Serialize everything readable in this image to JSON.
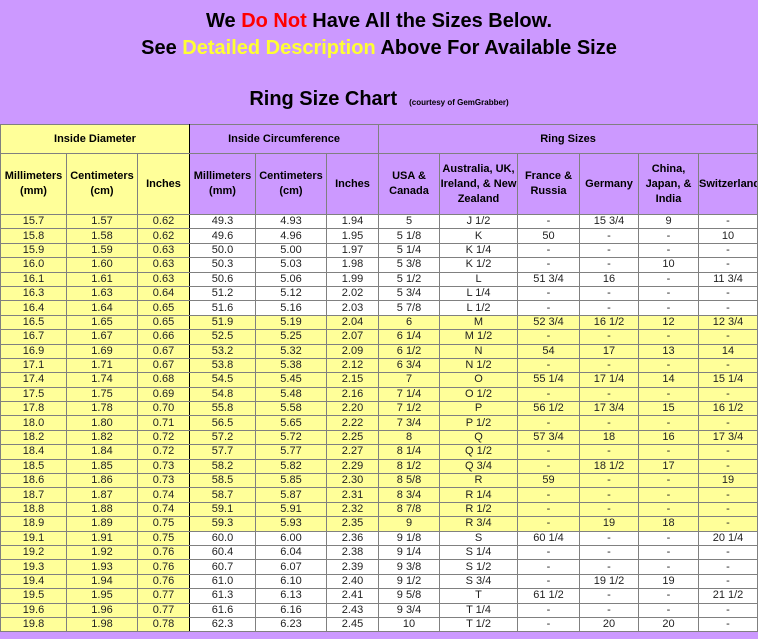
{
  "banner": {
    "line1": {
      "pre": "We ",
      "highlight": "Do Not",
      "post": " Have All the Sizes Below."
    },
    "line2": {
      "pre": "See ",
      "highlight": "Detailed Description",
      "post": " Above For Available Size"
    },
    "title": "Ring Size Chart",
    "courtesy": "(courtesy of GemGrabber)",
    "colors": {
      "background": "#cc99ff",
      "highlight_red": "#ff0000",
      "highlight_yellow": "#ffff33"
    }
  },
  "table": {
    "groups": [
      "Inside Diameter",
      "Inside Circumference",
      "Ring Sizes"
    ],
    "columns": [
      "Millimeters (mm)",
      "Centimeters (cm)",
      "Inches",
      "Millimeters (mm)",
      "Centimeters (cm)",
      "Inches",
      "USA & Canada",
      "Australia, UK, Ireland, & New Zealand",
      "France & Russia",
      "Germany",
      "China, Japan, & India",
      "Switzerland"
    ],
    "colors": {
      "yellow": "#ffff99",
      "purple": "#cc99ff",
      "white": "#ffffff"
    },
    "rows": [
      [
        "15.7",
        "1.57",
        "0.62",
        "49.3",
        "4.93",
        "1.94",
        "5",
        "J 1/2",
        "-",
        "15 3/4",
        "9",
        "-"
      ],
      [
        "15.8",
        "1.58",
        "0.62",
        "49.6",
        "4.96",
        "1.95",
        "5 1/8",
        "K",
        "50",
        "-",
        "-",
        "10"
      ],
      [
        "15.9",
        "1.59",
        "0.63",
        "50.0",
        "5.00",
        "1.97",
        "5 1/4",
        "K 1/4",
        "-",
        "-",
        "-",
        "-"
      ],
      [
        "16.0",
        "1.60",
        "0.63",
        "50.3",
        "5.03",
        "1.98",
        "5 3/8",
        "K 1/2",
        "-",
        "-",
        "10",
        "-"
      ],
      [
        "16.1",
        "1.61",
        "0.63",
        "50.6",
        "5.06",
        "1.99",
        "5 1/2",
        "L",
        "51 3/4",
        "16",
        "-",
        "11 3/4"
      ],
      [
        "16.3",
        "1.63",
        "0.64",
        "51.2",
        "5.12",
        "2.02",
        "5 3/4",
        "L 1/4",
        "-",
        "-",
        "-",
        "-"
      ],
      [
        "16.4",
        "1.64",
        "0.65",
        "51.6",
        "5.16",
        "2.03",
        "5 7/8",
        "L 1/2",
        "-",
        "-",
        "-",
        "-"
      ],
      [
        "16.5",
        "1.65",
        "0.65",
        "51.9",
        "5.19",
        "2.04",
        "6",
        "M",
        "52 3/4",
        "16 1/2",
        "12",
        "12 3/4"
      ],
      [
        "16.7",
        "1.67",
        "0.66",
        "52.5",
        "5.25",
        "2.07",
        "6 1/4",
        "M 1/2",
        "-",
        "-",
        "-",
        "-"
      ],
      [
        "16.9",
        "1.69",
        "0.67",
        "53.2",
        "5.32",
        "2.09",
        "6 1/2",
        "N",
        "54",
        "17",
        "13",
        "14"
      ],
      [
        "17.1",
        "1.71",
        "0.67",
        "53.8",
        "5.38",
        "2.12",
        "6 3/4",
        "N 1/2",
        "-",
        "-",
        "-",
        "-"
      ],
      [
        "17.4",
        "1.74",
        "0.68",
        "54.5",
        "5.45",
        "2.15",
        "7",
        "O",
        "55 1/4",
        "17 1/4",
        "14",
        "15 1/4"
      ],
      [
        "17.5",
        "1.75",
        "0.69",
        "54.8",
        "5.48",
        "2.16",
        "7 1/4",
        "O 1/2",
        "-",
        "-",
        "-",
        "-"
      ],
      [
        "17.8",
        "1.78",
        "0.70",
        "55.8",
        "5.58",
        "2.20",
        "7 1/2",
        "P",
        "56 1/2",
        "17 3/4",
        "15",
        "16 1/2"
      ],
      [
        "18.0",
        "1.80",
        "0.71",
        "56.5",
        "5.65",
        "2.22",
        "7 3/4",
        "P 1/2",
        "-",
        "-",
        "-",
        "-"
      ],
      [
        "18.2",
        "1.82",
        "0.72",
        "57.2",
        "5.72",
        "2.25",
        "8",
        "Q",
        "57 3/4",
        "18",
        "16",
        "17 3/4"
      ],
      [
        "18.4",
        "1.84",
        "0.72",
        "57.7",
        "5.77",
        "2.27",
        "8 1/4",
        "Q 1/2",
        "-",
        "-",
        "-",
        "-"
      ],
      [
        "18.5",
        "1.85",
        "0.73",
        "58.2",
        "5.82",
        "2.29",
        "8 1/2",
        "Q 3/4",
        "-",
        "18 1/2",
        "17",
        "-"
      ],
      [
        "18.6",
        "1.86",
        "0.73",
        "58.5",
        "5.85",
        "2.30",
        "8 5/8",
        "R",
        "59",
        "-",
        "-",
        "19"
      ],
      [
        "18.7",
        "1.87",
        "0.74",
        "58.7",
        "5.87",
        "2.31",
        "8 3/4",
        "R 1/4",
        "-",
        "-",
        "-",
        "-"
      ],
      [
        "18.8",
        "1.88",
        "0.74",
        "59.1",
        "5.91",
        "2.32",
        "8 7/8",
        "R 1/2",
        "-",
        "-",
        "-",
        "-"
      ],
      [
        "18.9",
        "1.89",
        "0.75",
        "59.3",
        "5.93",
        "2.35",
        "9",
        "R 3/4",
        "-",
        "19",
        "18",
        "-"
      ],
      [
        "19.1",
        "1.91",
        "0.75",
        "60.0",
        "6.00",
        "2.36",
        "9 1/8",
        "S",
        "60 1/4",
        "-",
        "-",
        "20 1/4"
      ],
      [
        "19.2",
        "1.92",
        "0.76",
        "60.4",
        "6.04",
        "2.38",
        "9 1/4",
        "S 1/4",
        "-",
        "-",
        "-",
        "-"
      ],
      [
        "19.3",
        "1.93",
        "0.76",
        "60.7",
        "6.07",
        "2.39",
        "9 3/8",
        "S 1/2",
        "-",
        "-",
        "-",
        "-"
      ],
      [
        "19.4",
        "1.94",
        "0.76",
        "61.0",
        "6.10",
        "2.40",
        "9 1/2",
        "S 3/4",
        "-",
        "19 1/2",
        "19",
        "-"
      ],
      [
        "19.5",
        "1.95",
        "0.77",
        "61.3",
        "6.13",
        "2.41",
        "9 5/8",
        "T",
        "61 1/2",
        "-",
        "-",
        "21 1/2"
      ],
      [
        "19.6",
        "1.96",
        "0.77",
        "61.6",
        "6.16",
        "2.43",
        "9 3/4",
        "T 1/4",
        "-",
        "-",
        "-",
        "-"
      ],
      [
        "19.8",
        "1.98",
        "0.78",
        "62.3",
        "6.23",
        "2.45",
        "10",
        "T 1/2",
        "-",
        "20",
        "20",
        "-"
      ]
    ],
    "highlighted_row_range": [
      7,
      21
    ]
  }
}
